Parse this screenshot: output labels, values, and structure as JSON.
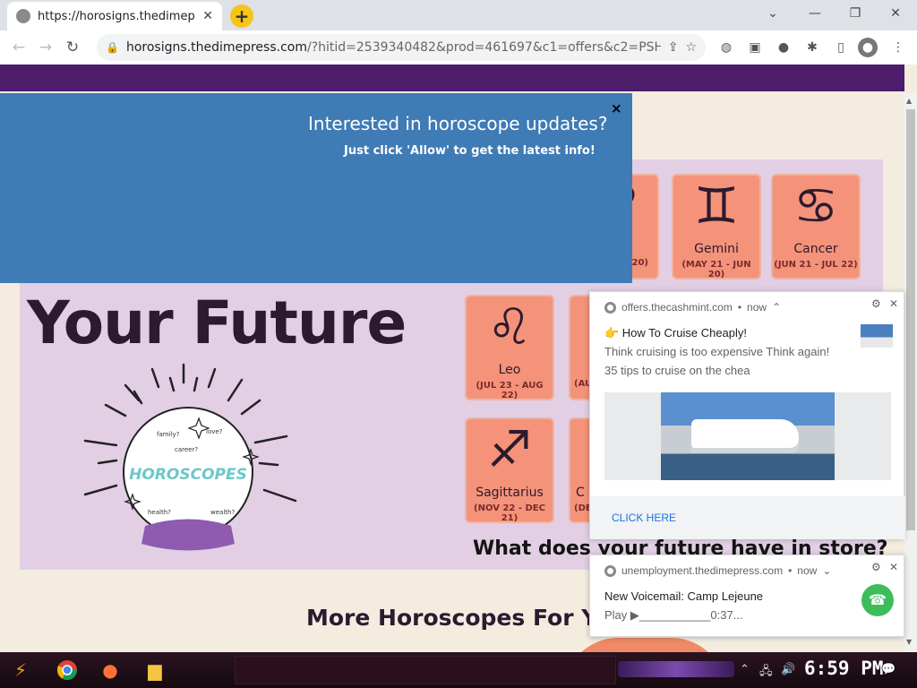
{
  "browser": {
    "tab_title": "https://horosigns.thedimepress",
    "url_host": "horosigns.thedimepress.com",
    "url_rest": "/?hitid=2539340482&prod=461697&c1=offers&c2=PSH_o..."
  },
  "popup": {
    "title": "Interested in horoscope updates?",
    "subtitle": "Just click 'Allow' to get the latest info!",
    "close": "×"
  },
  "page": {
    "hero_line": "Your Future",
    "ball_label": "HOROSCOPES",
    "future_question": "What does your future have in store?",
    "more_heading": "More Horoscopes For You"
  },
  "cards": [
    {
      "glyph": "♈",
      "name": "",
      "dates": "20)"
    },
    {
      "glyph": "♊",
      "name": "Gemini",
      "dates": "(MAY 21 - JUN 20)"
    },
    {
      "glyph": "♋",
      "name": "Cancer",
      "dates": "(JUN 21 - JUL 22)"
    },
    {
      "glyph": "♌",
      "name": "Leo",
      "dates": "(JUL 23 - AUG 22)"
    },
    {
      "glyph": "♍",
      "name": "",
      "dates": "(AU"
    },
    {
      "glyph": "♐",
      "name": "Sagittarius",
      "dates": "(NOV 22 - DEC 21)"
    },
    {
      "glyph": "♑",
      "name": "C",
      "dates": "(DE"
    }
  ],
  "notifications": [
    {
      "source": "offers.thecashmint.com",
      "time": "now",
      "title": "👉 How To Cruise Cheaply!",
      "body1": "Think cruising is too expensive  Think again!",
      "body2": "35 tips to cruise on the chea",
      "action": "CLICK HERE"
    },
    {
      "source": "unemployment.thedimepress.com",
      "time": "now",
      "title": "New Voicemail: Camp Lejeune",
      "body1": "Play ▶___________0:37..."
    }
  ],
  "taskbar": {
    "clock": "6:59 PM"
  },
  "colors": {
    "popup": "#3f7bb5",
    "card": "#f4937a",
    "panel": "#e2cfe4",
    "purple_bar": "#4c1d6b"
  }
}
